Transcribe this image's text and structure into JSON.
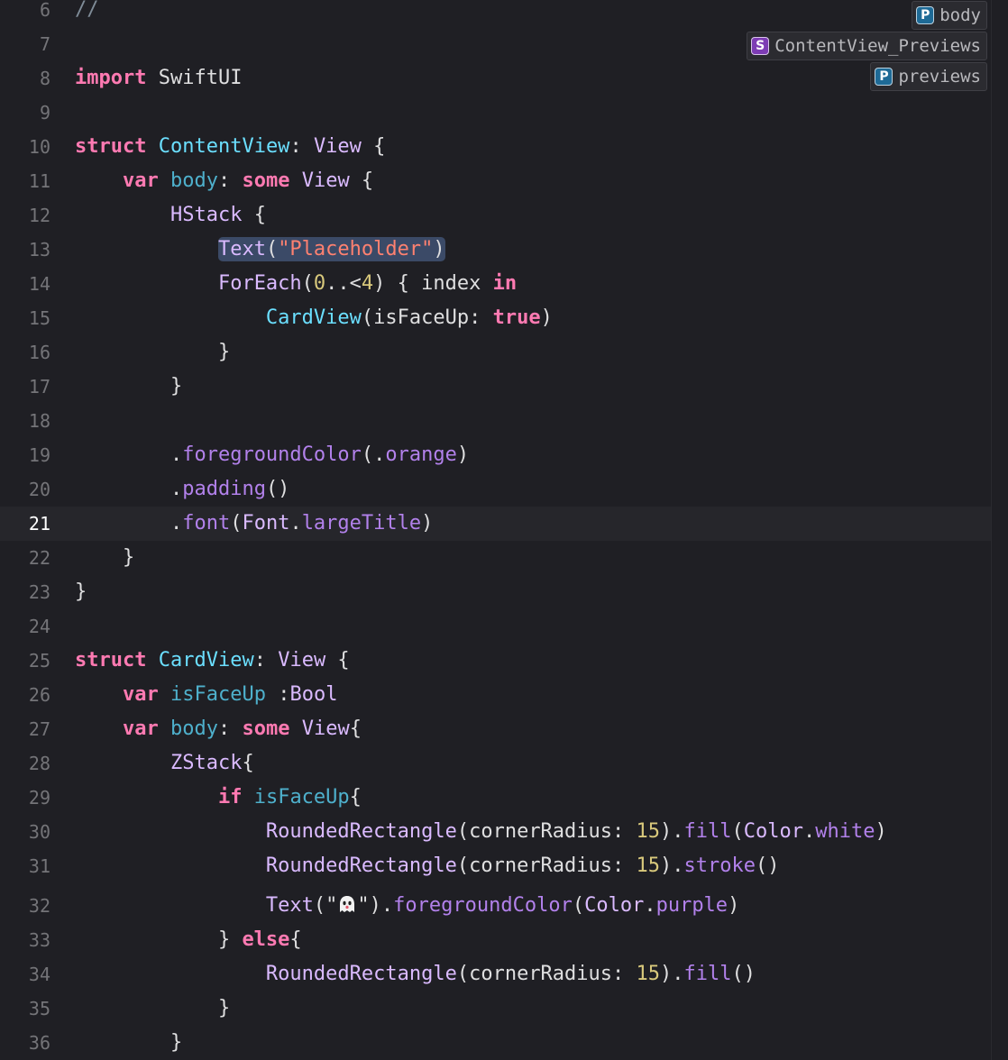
{
  "editor": {
    "current_line": 21,
    "highlight_line": 13,
    "lines": [
      {
        "n": "6",
        "tokens": [
          {
            "t": "//",
            "c": "comment"
          }
        ]
      },
      {
        "n": "7",
        "tokens": []
      },
      {
        "n": "8",
        "tokens": [
          {
            "t": "import",
            "c": "kw"
          },
          {
            "t": " SwiftUI",
            "c": "plain"
          }
        ]
      },
      {
        "n": "9",
        "tokens": []
      },
      {
        "n": "10",
        "tokens": [
          {
            "t": "struct",
            "c": "kw"
          },
          {
            "t": " ",
            "c": "plain"
          },
          {
            "t": "ContentView",
            "c": "type"
          },
          {
            "t": ": ",
            "c": "plain"
          },
          {
            "t": "View",
            "c": "typeref"
          },
          {
            "t": " {",
            "c": "plain"
          }
        ]
      },
      {
        "n": "11",
        "tokens": [
          {
            "t": "    ",
            "c": "plain"
          },
          {
            "t": "var",
            "c": "kw"
          },
          {
            "t": " ",
            "c": "plain"
          },
          {
            "t": "body",
            "c": "ident"
          },
          {
            "t": ": ",
            "c": "plain"
          },
          {
            "t": "some",
            "c": "kw"
          },
          {
            "t": " ",
            "c": "plain"
          },
          {
            "t": "View",
            "c": "typeref"
          },
          {
            "t": " {",
            "c": "plain"
          }
        ]
      },
      {
        "n": "12",
        "tokens": [
          {
            "t": "        ",
            "c": "plain"
          },
          {
            "t": "HStack",
            "c": "typeref"
          },
          {
            "t": " {",
            "c": "plain"
          }
        ]
      },
      {
        "n": "13",
        "tokens": [
          {
            "t": "            ",
            "c": "plain"
          },
          {
            "t": "Text",
            "c": "typeref",
            "hl": "start"
          },
          {
            "t": "(",
            "c": "plain",
            "hl": "mid"
          },
          {
            "t": "\"Placeholder\"",
            "c": "str",
            "hl": "mid"
          },
          {
            "t": ")",
            "c": "plain",
            "hl": "end"
          }
        ]
      },
      {
        "n": "14",
        "tokens": [
          {
            "t": "            ",
            "c": "plain"
          },
          {
            "t": "ForEach",
            "c": "typeref"
          },
          {
            "t": "(",
            "c": "plain"
          },
          {
            "t": "0",
            "c": "num"
          },
          {
            "t": "..<",
            "c": "plain"
          },
          {
            "t": "4",
            "c": "num"
          },
          {
            "t": ") { index ",
            "c": "plain"
          },
          {
            "t": "in",
            "c": "kw"
          }
        ]
      },
      {
        "n": "15",
        "tokens": [
          {
            "t": "                ",
            "c": "plain"
          },
          {
            "t": "CardView",
            "c": "type"
          },
          {
            "t": "(isFaceUp: ",
            "c": "plain"
          },
          {
            "t": "true",
            "c": "kw"
          },
          {
            "t": ")",
            "c": "plain"
          }
        ]
      },
      {
        "n": "16",
        "tokens": [
          {
            "t": "            }",
            "c": "plain"
          }
        ]
      },
      {
        "n": "17",
        "tokens": [
          {
            "t": "        }",
            "c": "plain"
          }
        ]
      },
      {
        "n": "18",
        "tokens": []
      },
      {
        "n": "19",
        "tokens": [
          {
            "t": "        .",
            "c": "plain"
          },
          {
            "t": "foregroundColor",
            "c": "method"
          },
          {
            "t": "(.",
            "c": "plain"
          },
          {
            "t": "orange",
            "c": "member"
          },
          {
            "t": ")",
            "c": "plain"
          }
        ]
      },
      {
        "n": "20",
        "tokens": [
          {
            "t": "        .",
            "c": "plain"
          },
          {
            "t": "padding",
            "c": "method"
          },
          {
            "t": "()",
            "c": "plain"
          }
        ]
      },
      {
        "n": "21",
        "tokens": [
          {
            "t": "        .",
            "c": "plain"
          },
          {
            "t": "font",
            "c": "method"
          },
          {
            "t": "(",
            "c": "plain"
          },
          {
            "t": "Font",
            "c": "typeref"
          },
          {
            "t": ".",
            "c": "plain"
          },
          {
            "t": "largeTitle",
            "c": "member"
          },
          {
            "t": ")",
            "c": "plain"
          }
        ]
      },
      {
        "n": "22",
        "tokens": [
          {
            "t": "    }",
            "c": "plain"
          }
        ]
      },
      {
        "n": "23",
        "tokens": [
          {
            "t": "}",
            "c": "plain"
          }
        ]
      },
      {
        "n": "24",
        "tokens": []
      },
      {
        "n": "25",
        "tokens": [
          {
            "t": "struct",
            "c": "kw"
          },
          {
            "t": " ",
            "c": "plain"
          },
          {
            "t": "CardView",
            "c": "type"
          },
          {
            "t": ": ",
            "c": "plain"
          },
          {
            "t": "View",
            "c": "typeref"
          },
          {
            "t": " {",
            "c": "plain"
          }
        ]
      },
      {
        "n": "26",
        "tokens": [
          {
            "t": "    ",
            "c": "plain"
          },
          {
            "t": "var",
            "c": "kw"
          },
          {
            "t": " ",
            "c": "plain"
          },
          {
            "t": "isFaceUp",
            "c": "ident"
          },
          {
            "t": " :",
            "c": "plain"
          },
          {
            "t": "Bool",
            "c": "typeref"
          }
        ]
      },
      {
        "n": "27",
        "tokens": [
          {
            "t": "    ",
            "c": "plain"
          },
          {
            "t": "var",
            "c": "kw"
          },
          {
            "t": " ",
            "c": "plain"
          },
          {
            "t": "body",
            "c": "ident"
          },
          {
            "t": ": ",
            "c": "plain"
          },
          {
            "t": "some",
            "c": "kw"
          },
          {
            "t": " ",
            "c": "plain"
          },
          {
            "t": "View",
            "c": "typeref"
          },
          {
            "t": "{",
            "c": "plain"
          }
        ]
      },
      {
        "n": "28",
        "tokens": [
          {
            "t": "        ",
            "c": "plain"
          },
          {
            "t": "ZStack",
            "c": "typeref"
          },
          {
            "t": "{",
            "c": "plain"
          }
        ]
      },
      {
        "n": "29",
        "tokens": [
          {
            "t": "            ",
            "c": "plain"
          },
          {
            "t": "if",
            "c": "kw"
          },
          {
            "t": " ",
            "c": "plain"
          },
          {
            "t": "isFaceUp",
            "c": "ident"
          },
          {
            "t": "{",
            "c": "plain"
          }
        ]
      },
      {
        "n": "30",
        "tokens": [
          {
            "t": "                ",
            "c": "plain"
          },
          {
            "t": "RoundedRectangle",
            "c": "typeref"
          },
          {
            "t": "(cornerRadius: ",
            "c": "plain"
          },
          {
            "t": "15",
            "c": "num"
          },
          {
            "t": ").",
            "c": "plain"
          },
          {
            "t": "fill",
            "c": "method"
          },
          {
            "t": "(",
            "c": "plain"
          },
          {
            "t": "Color",
            "c": "typeref"
          },
          {
            "t": ".",
            "c": "plain"
          },
          {
            "t": "white",
            "c": "member"
          },
          {
            "t": ")",
            "c": "plain"
          }
        ]
      },
      {
        "n": "31",
        "tokens": [
          {
            "t": "                ",
            "c": "plain"
          },
          {
            "t": "RoundedRectangle",
            "c": "typeref"
          },
          {
            "t": "(cornerRadius: ",
            "c": "plain"
          },
          {
            "t": "15",
            "c": "num"
          },
          {
            "t": ").",
            "c": "plain"
          },
          {
            "t": "stroke",
            "c": "method"
          },
          {
            "t": "()",
            "c": "plain"
          }
        ]
      },
      {
        "n": "32",
        "tokens": [
          {
            "t": "                ",
            "c": "plain"
          },
          {
            "t": "Text",
            "c": "typeref"
          },
          {
            "t": "(\"",
            "c": "plain"
          },
          {
            "t": "ghost",
            "c": "ghost"
          },
          {
            "t": "\").",
            "c": "plain"
          },
          {
            "t": "foregroundColor",
            "c": "method"
          },
          {
            "t": "(",
            "c": "plain"
          },
          {
            "t": "Color",
            "c": "typeref"
          },
          {
            "t": ".",
            "c": "plain"
          },
          {
            "t": "purple",
            "c": "member"
          },
          {
            "t": ")",
            "c": "plain"
          }
        ]
      },
      {
        "n": "33",
        "tokens": [
          {
            "t": "            } ",
            "c": "plain"
          },
          {
            "t": "else",
            "c": "kw"
          },
          {
            "t": "{",
            "c": "plain"
          }
        ]
      },
      {
        "n": "34",
        "tokens": [
          {
            "t": "                ",
            "c": "plain"
          },
          {
            "t": "RoundedRectangle",
            "c": "typeref"
          },
          {
            "t": "(cornerRadius: ",
            "c": "plain"
          },
          {
            "t": "15",
            "c": "num"
          },
          {
            "t": ").",
            "c": "plain"
          },
          {
            "t": "fill",
            "c": "method"
          },
          {
            "t": "()",
            "c": "plain"
          }
        ]
      },
      {
        "n": "35",
        "tokens": [
          {
            "t": "            }",
            "c": "plain"
          }
        ]
      },
      {
        "n": "36",
        "tokens": [
          {
            "t": "        }",
            "c": "plain"
          }
        ]
      }
    ]
  },
  "symbol_chips": [
    {
      "badge": "P",
      "label": "body",
      "kind": "property"
    },
    {
      "badge": "S",
      "label": "ContentView_Previews",
      "kind": "struct"
    },
    {
      "badge": "P",
      "label": "previews",
      "kind": "property"
    }
  ],
  "colors": {
    "background": "#1f1f24",
    "current_line": "#26262b",
    "keyword": "#ff7ab2",
    "type_decl": "#6bdfff",
    "string": "#ff8170",
    "number": "#d9c97c",
    "method": "#b281eb",
    "highlight": "#3b4a67"
  }
}
